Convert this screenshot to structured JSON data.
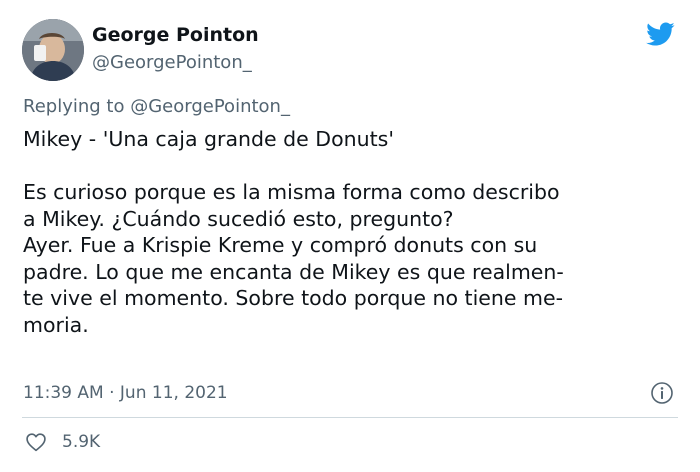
{
  "author": {
    "name": "George Pointon",
    "handle": "@GeorgePointon_"
  },
  "reply": {
    "label": "Replying to",
    "handle": "@GeorgePointon_"
  },
  "body": {
    "line1": "Mikey - 'Una caja grande de Donuts'",
    "line3": "Es curioso porque es la misma forma como describo",
    "line4": "a Mikey. ¿Cuándo sucedió esto, pregunto?",
    "line5": "Ayer. Fue a Krispie Kreme y compró donuts con su",
    "line6": "padre. Lo que me encanta de Mikey es que realmen-",
    "line7": "te vive el momento. Sobre todo porque no tiene me-",
    "line8": "moria."
  },
  "meta": {
    "time": "11:39 AM",
    "separator": "·",
    "date": "Jun 11, 2021"
  },
  "stats": {
    "likes": "5.9K"
  },
  "colors": {
    "brand_blue": "#1d9bf0",
    "text_primary": "#0f1419",
    "text_secondary": "#536471",
    "divider": "#cfd9de"
  },
  "icons": {
    "brand": "twitter-bird-icon",
    "info": "info-icon",
    "like": "heart-icon"
  }
}
